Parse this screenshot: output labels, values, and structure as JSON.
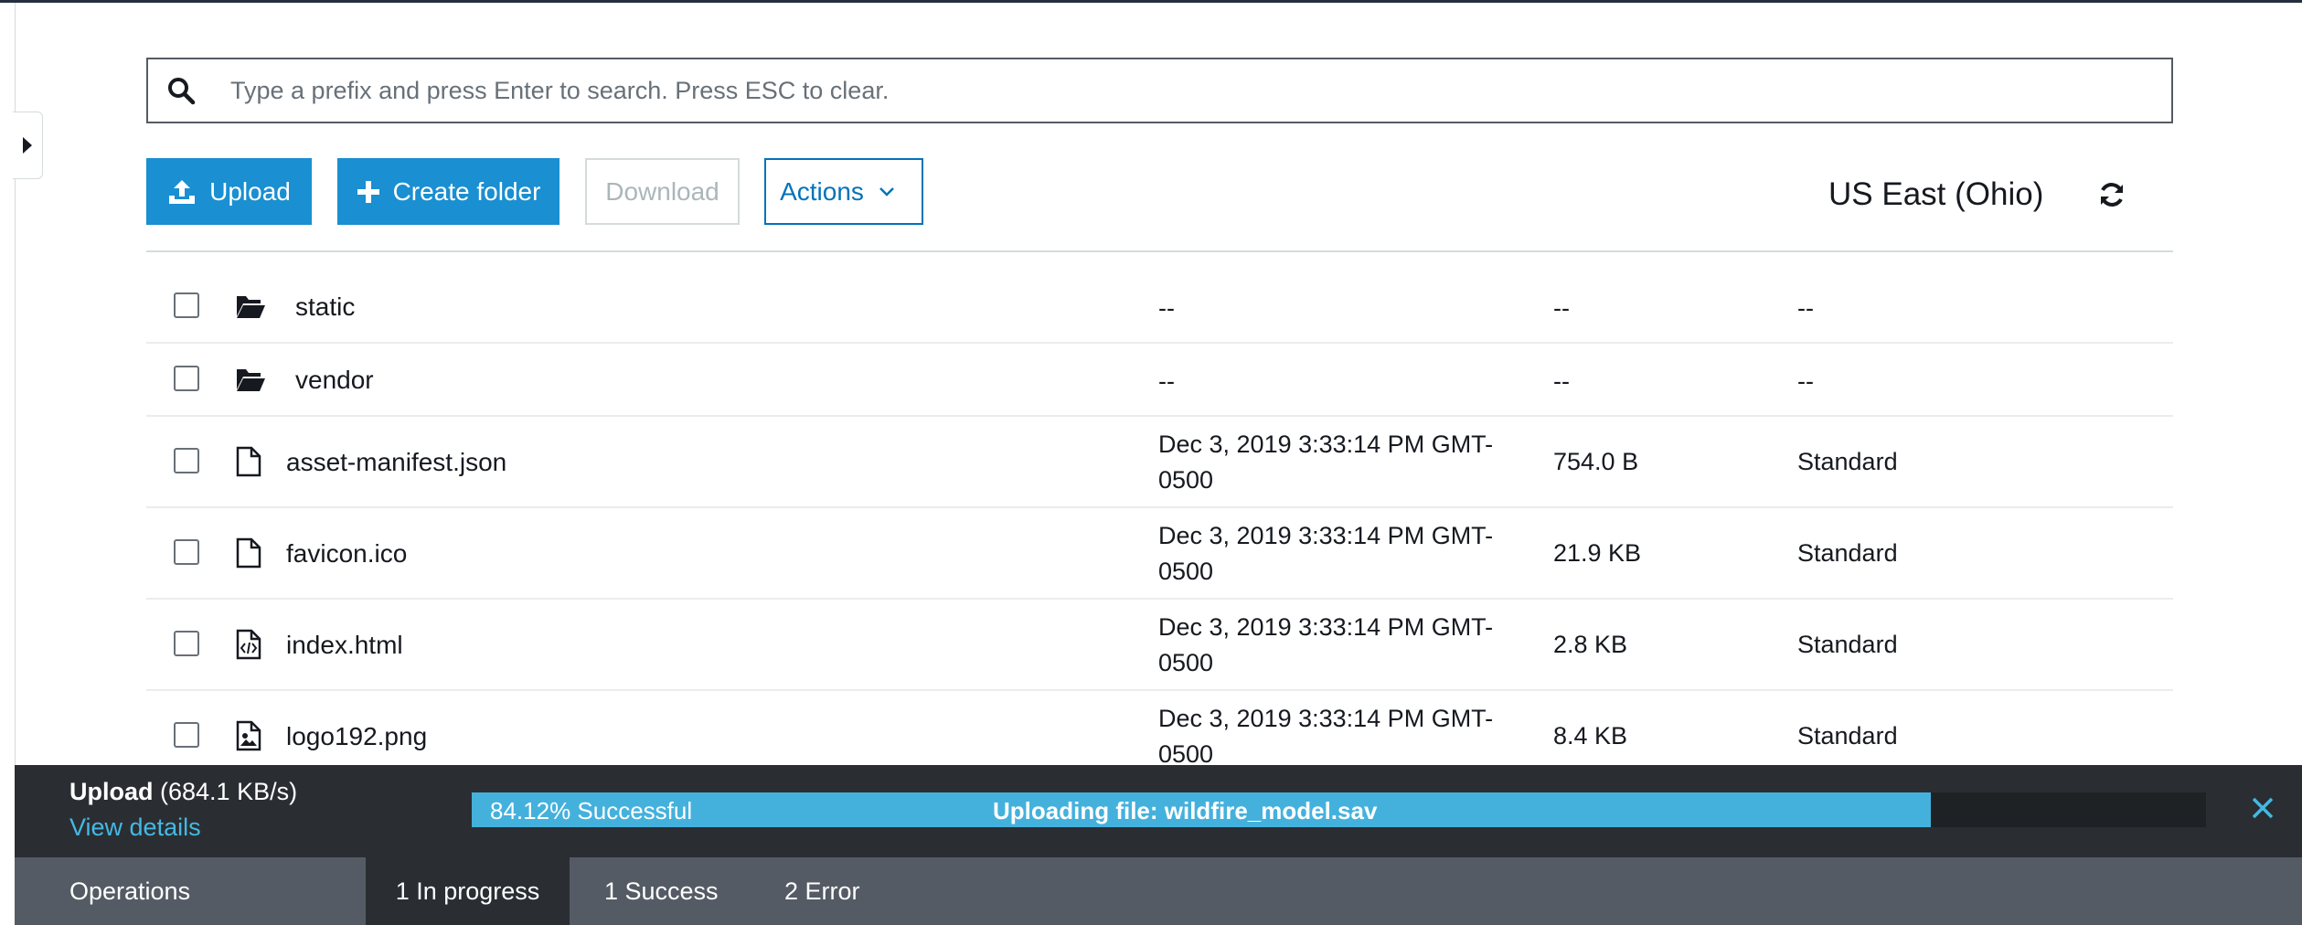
{
  "search": {
    "placeholder": "Type a prefix and press Enter to search. Press ESC to clear."
  },
  "toolbar": {
    "upload_label": "Upload",
    "create_folder_label": "Create folder",
    "download_label": "Download",
    "actions_label": "Actions",
    "region": "US East (Ohio)"
  },
  "rows": [
    {
      "type": "folder",
      "name": "static",
      "modified": "--",
      "size": "--",
      "storage": "--"
    },
    {
      "type": "folder",
      "name": "vendor",
      "modified": "--",
      "size": "--",
      "storage": "--"
    },
    {
      "type": "file",
      "name": "asset-manifest.json",
      "modified": "Dec 3, 2019 3:33:14 PM GMT-0500",
      "size": "754.0 B",
      "storage": "Standard"
    },
    {
      "type": "file",
      "name": "favicon.ico",
      "modified": "Dec 3, 2019 3:33:14 PM GMT-0500",
      "size": "21.9 KB",
      "storage": "Standard"
    },
    {
      "type": "code",
      "name": "index.html",
      "modified": "Dec 3, 2019 3:33:14 PM GMT-0500",
      "size": "2.8 KB",
      "storage": "Standard"
    },
    {
      "type": "image",
      "name": "logo192.png",
      "modified": "Dec 3, 2019 3:33:14 PM GMT-0500",
      "size": "8.4 KB",
      "storage": "Standard"
    }
  ],
  "upload": {
    "title": "Upload",
    "speed": "(684.1 KB/s)",
    "view_details": "View details",
    "progress": 0.8412,
    "progress_text": "84.12% Successful",
    "file_text": "Uploading file: wildfire_model.sav",
    "bar_fill_color": "#44b1dd",
    "tabs": {
      "operations": "Operations",
      "in_progress": "1 In progress",
      "success": "1 Success",
      "error": "2 Error"
    }
  }
}
